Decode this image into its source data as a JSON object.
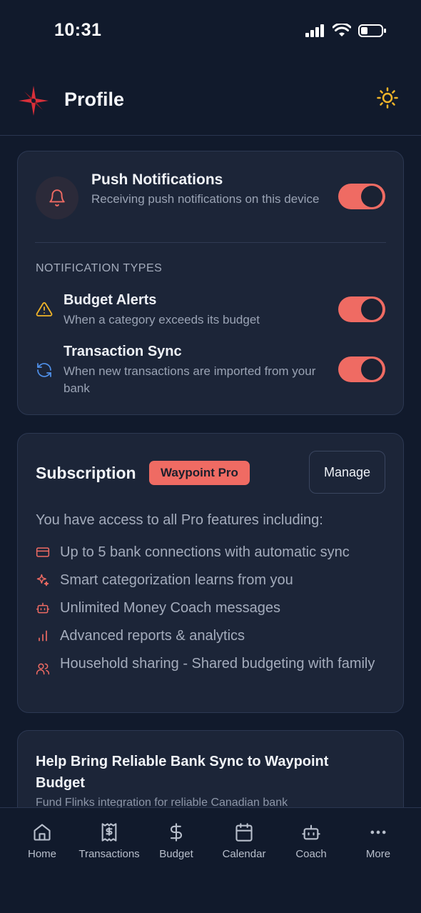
{
  "status_bar": {
    "time": "10:31"
  },
  "header": {
    "title": "Profile"
  },
  "notifications": {
    "title": "Push Notifications",
    "description": "Receiving push notifications on this device",
    "enabled": true,
    "types_label": "NOTIFICATION TYPES",
    "items": [
      {
        "title": "Budget Alerts",
        "description": "When a category exceeds its budget",
        "enabled": true
      },
      {
        "title": "Transaction Sync",
        "description": "When new transactions are imported from your bank",
        "enabled": true
      }
    ]
  },
  "subscription": {
    "title": "Subscription",
    "badge": "Waypoint Pro",
    "manage_label": "Manage",
    "access_text": "You have access to all Pro features including:",
    "features": [
      {
        "icon": "credit-card-icon",
        "text": "Up to 5 bank connections with automatic sync"
      },
      {
        "icon": "sparkles-icon",
        "text": "Smart categorization learns from you"
      },
      {
        "icon": "bot-icon",
        "text": "Unlimited Money Coach messages"
      },
      {
        "icon": "bar-chart-icon",
        "text": "Advanced reports & analytics"
      },
      {
        "icon": "users-icon",
        "text": "Household sharing - Shared budgeting with family"
      }
    ]
  },
  "help_card": {
    "title": "Help Bring Reliable Bank Sync to Waypoint Budget",
    "description": "Fund Flinks integration for reliable Canadian bank"
  },
  "nav": {
    "items": [
      {
        "label": "Home",
        "icon": "home-icon"
      },
      {
        "label": "Transactions",
        "icon": "receipt-icon"
      },
      {
        "label": "Budget",
        "icon": "dollar-icon"
      },
      {
        "label": "Calendar",
        "icon": "calendar-icon"
      },
      {
        "label": "Coach",
        "icon": "bot-icon"
      },
      {
        "label": "More",
        "icon": "more-icon"
      }
    ]
  },
  "colors": {
    "background": "#111a2c",
    "card": "#1c2538",
    "accent": "#ef6b63",
    "warning": "#f0b429",
    "sync_blue": "#4f8fe8"
  }
}
